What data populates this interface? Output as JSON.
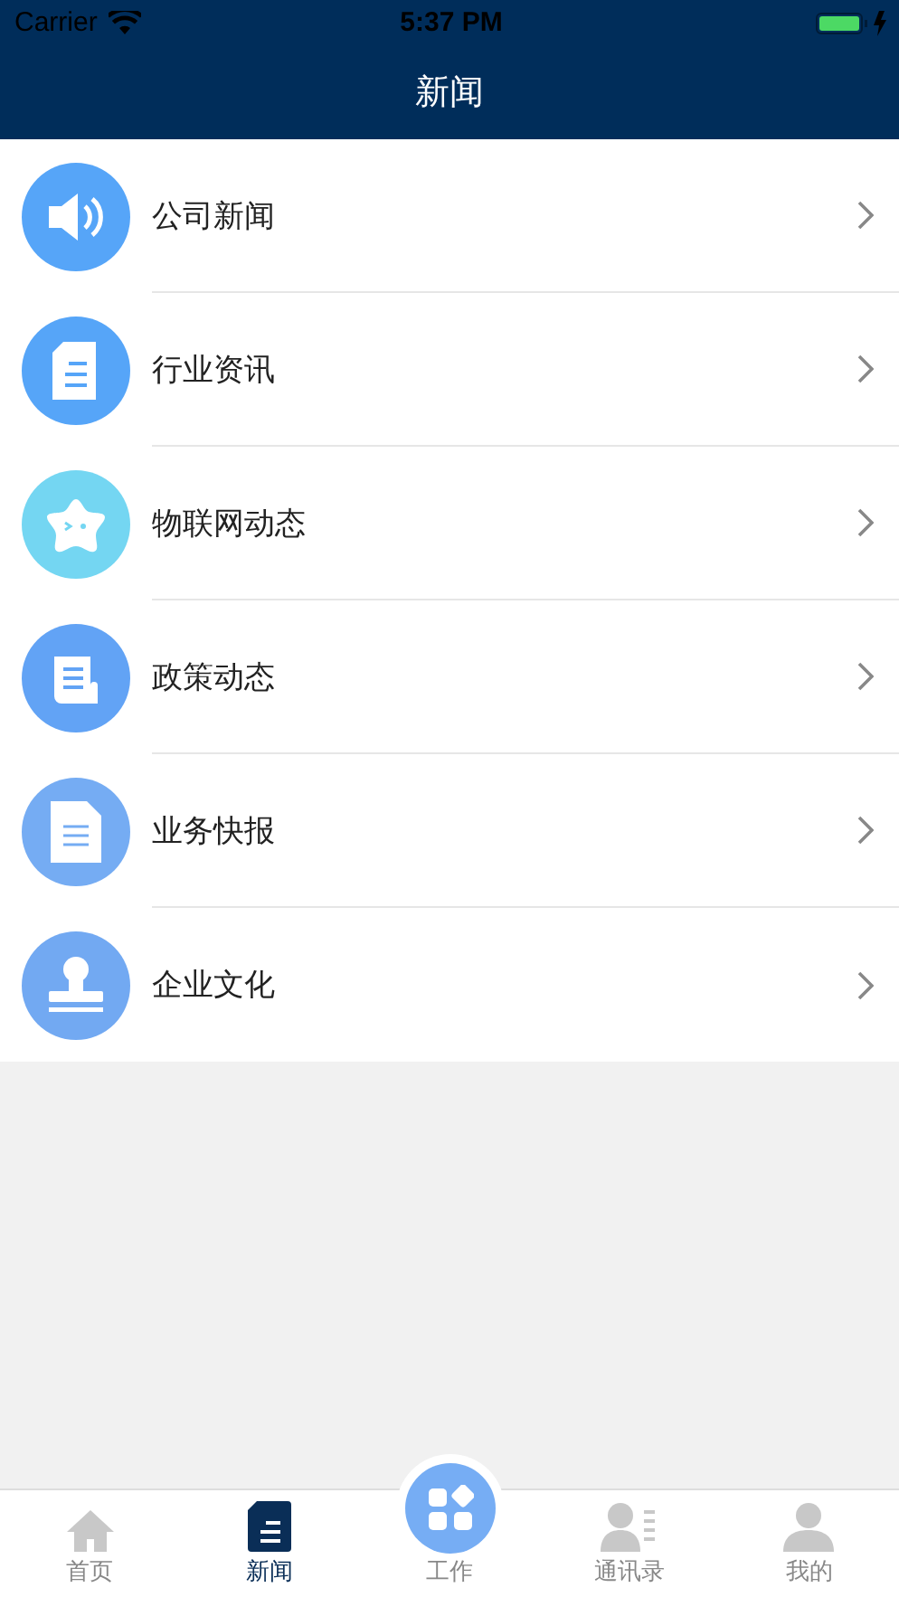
{
  "status_bar": {
    "carrier": "Carrier",
    "time": "5:37 PM"
  },
  "nav_bar": {
    "title": "新闻"
  },
  "news_categories": [
    {
      "label": "公司新闻",
      "kind": "speaker",
      "color": "#56a5f8"
    },
    {
      "label": "行业资讯",
      "kind": "document",
      "color": "#56a5f8"
    },
    {
      "label": "物联网动态",
      "kind": "star",
      "color": "#74d6f2"
    },
    {
      "label": "政策动态",
      "kind": "scroll",
      "color": "#62a3f5"
    },
    {
      "label": "业务快报",
      "kind": "page",
      "color": "#75acf3"
    },
    {
      "label": "企业文化",
      "kind": "stamp",
      "color": "#72a9f2"
    }
  ],
  "tab_bar": [
    {
      "label": "首页",
      "kind": "home",
      "selected": false
    },
    {
      "label": "新闻",
      "kind": "news",
      "selected": true
    },
    {
      "label": "工作",
      "kind": "center",
      "selected": false
    },
    {
      "label": "通讯录",
      "kind": "contacts",
      "selected": false
    },
    {
      "label": "我的",
      "kind": "profile",
      "selected": false
    }
  ]
}
